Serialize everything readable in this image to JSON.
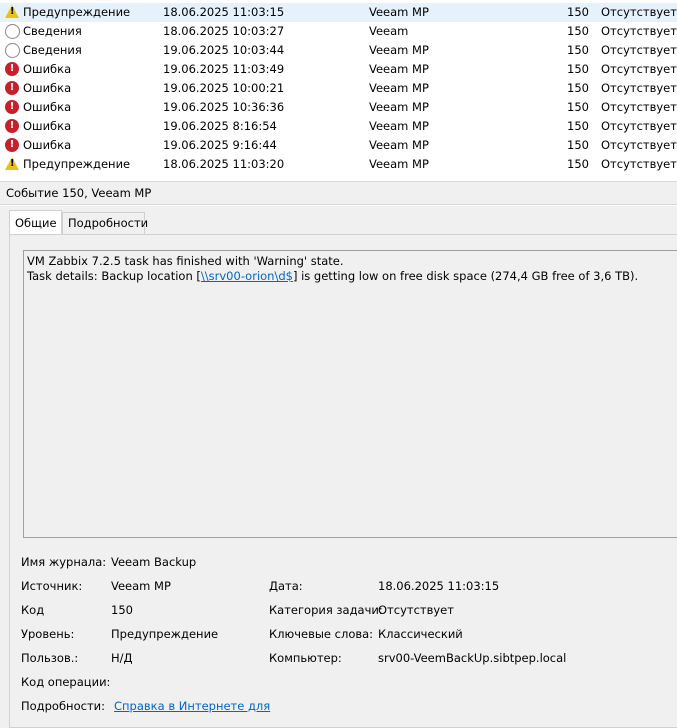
{
  "events": [
    {
      "icon": "warning",
      "level": "Предупреждение",
      "datetime": "18.06.2025 11:03:15",
      "source": "Veeam MP",
      "id": "150",
      "category": "Отсутствует",
      "selected": true
    },
    {
      "icon": "info",
      "level": "Сведения",
      "datetime": "18.06.2025 10:03:27",
      "source": "Veeam",
      "id": "150",
      "category": "Отсутствует",
      "selected": false
    },
    {
      "icon": "info",
      "level": "Сведения",
      "datetime": "19.06.2025 10:03:44",
      "source": "Veeam MP",
      "id": "150",
      "category": "Отсутствует",
      "selected": false
    },
    {
      "icon": "error",
      "level": "Ошибка",
      "datetime": "19.06.2025 11:03:49",
      "source": "Veeam MP",
      "id": "150",
      "category": "Отсутствует",
      "selected": false
    },
    {
      "icon": "error",
      "level": "Ошибка",
      "datetime": "19.06.2025 10:00:21",
      "source": "Veeam MP",
      "id": "150",
      "category": "Отсутствует",
      "selected": false
    },
    {
      "icon": "error",
      "level": "Ошибка",
      "datetime": "19.06.2025 10:36:36",
      "source": "Veeam MP",
      "id": "150",
      "category": "Отсутствует",
      "selected": false
    },
    {
      "icon": "error",
      "level": "Ошибка",
      "datetime": "19.06.2025 8:16:54",
      "source": "Veeam MP",
      "id": "150",
      "category": "Отсутствует",
      "selected": false
    },
    {
      "icon": "error",
      "level": "Ошибка",
      "datetime": "19.06.2025 9:16:44",
      "source": "Veeam MP",
      "id": "150",
      "category": "Отсутствует",
      "selected": false
    },
    {
      "icon": "warning",
      "level": "Предупреждение",
      "datetime": "18.06.2025 11:03:20",
      "source": "Veeam MP",
      "id": "150",
      "category": "Отсутствует",
      "selected": false
    }
  ],
  "detail_header": "Событие 150, Veeam MP",
  "tabs": [
    "Общие",
    "Подробности"
  ],
  "message": {
    "line1": "VM Zabbix 7.2.5 task has finished with 'Warning' state.",
    "line2_prefix": "Task details: Backup location [",
    "line2_link": "\\\\srv00-orion\\d$",
    "line2_suffix": "] is getting low on free disk space (274,4 GB free of 3,6 TB)."
  },
  "fields": {
    "log_label": "Имя журнала:",
    "log_value": "Veeam Backup",
    "source_label": "Источник:",
    "source_value": "Veeam MP",
    "date_label": "Дата:",
    "date_value": "18.06.2025 11:03:15",
    "code_label": "Код",
    "code_value": "150",
    "task_label": "Категория задачи:",
    "task_value": "Отсутствует",
    "level_label": "Уровень:",
    "level_value": "Предупреждение",
    "keywords_label": "Ключевые слова:",
    "keywords_value": "Классический",
    "user_label": "Пользов.:",
    "user_value": "Н/Д",
    "computer_label": "Компьютер:",
    "computer_value": "srv00-VeemBackUp.sibtpep.local",
    "opcode_label": "Код операции:",
    "opcode_value": "",
    "more_label": "Подробности:",
    "more_link": "Справка в Интернете для "
  }
}
